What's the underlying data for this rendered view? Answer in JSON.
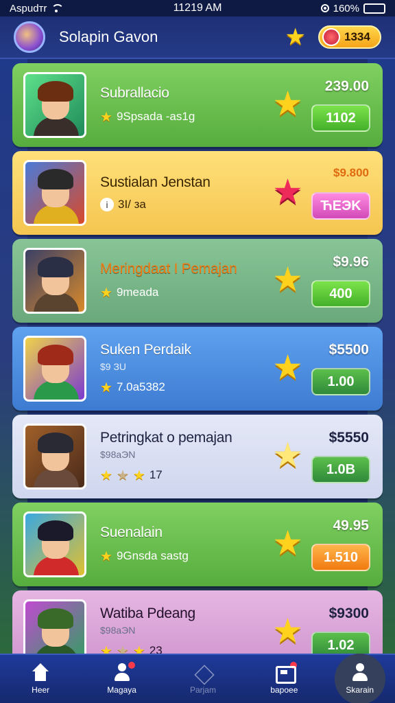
{
  "status_bar": {
    "carrier": "Aspudтr",
    "time": "11219 AM",
    "battery": "160%"
  },
  "header": {
    "title": "Solapin Gavon",
    "coins": "1334"
  },
  "games": [
    {
      "title": "Subrallacio",
      "meta": "9Spsada -as1g",
      "price": "239.00",
      "button": "1102"
    },
    {
      "title": "Sustialan Jenstan",
      "meta": "3I/ зa",
      "price": "$9.800",
      "button": "ЋEЭK"
    },
    {
      "title": "Meringdaat I Pemajan",
      "meta": "9meada",
      "price": "$9.96",
      "button": "400"
    },
    {
      "title": "Suken Perdaik",
      "sub": "$9 ЗU",
      "meta": "7.0a5382",
      "price": "$5500",
      "button": "1.00"
    },
    {
      "title": "Petringkat o pemajan",
      "sub": "$98aЭN",
      "meta": "17",
      "price": "$5550",
      "button": "1.0B"
    },
    {
      "title": "Suenalain",
      "meta": "9Gnsda sastg",
      "price": "49.95",
      "button": "1.510"
    },
    {
      "title": "Watiba Pdeang",
      "sub": "$98aЭN",
      "meta": "23",
      "price": "$9300",
      "button": "1.02"
    }
  ],
  "nav": {
    "home": "Heer",
    "players": "Magaya",
    "packs": "Parjam",
    "inbox": "bapoee",
    "profile": "Skarain"
  },
  "icons": {
    "rating": "star-icon",
    "info": "i"
  }
}
